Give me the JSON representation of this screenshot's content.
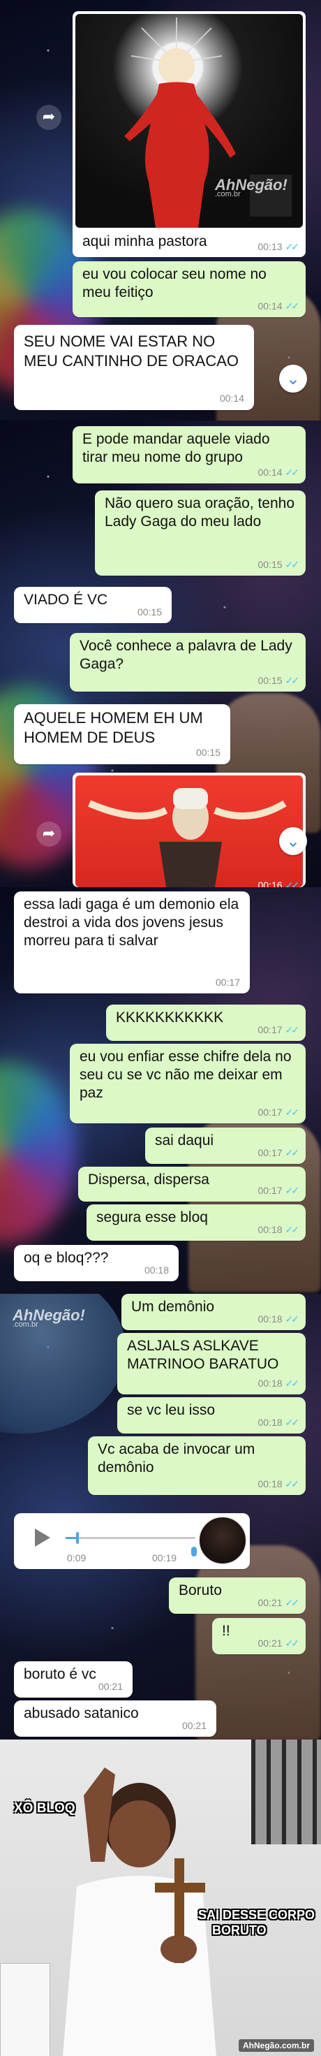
{
  "panel1": {
    "photo_watermark": "AhNegão!",
    "photo_watermark_sub": ".com.br",
    "messages": [
      {
        "text": "aqui minha pastora",
        "time": "00:13"
      },
      {
        "text": "eu vou colocar seu nome no meu feitiço",
        "time": "00:14"
      },
      {
        "text": "SEU NOME VAI ESTAR NO MEU CANTINHO DE ORACAO",
        "time": "00:14"
      }
    ]
  },
  "panel2": {
    "messages": [
      {
        "text": "E pode mandar aquele viado tirar meu nome do grupo",
        "time": "00:14"
      },
      {
        "text": "Não quero sua oração, tenho Lady Gaga do meu lado",
        "time": "00:15"
      },
      {
        "text": "VIADO É VC",
        "time": "00:15"
      },
      {
        "text": "Você conhece a palavra de Lady Gaga?",
        "time": "00:15"
      },
      {
        "text": "AQUELE HOMEM EH UM HOMEM DE DEUS",
        "time": "00:15"
      },
      {
        "text": "",
        "time": "00:16"
      }
    ]
  },
  "panel3": {
    "messages": [
      {
        "text": "essa ladi gaga é um demonio ela destroi a vida dos jovens jesus morreu para ti salvar",
        "time": "00:17"
      },
      {
        "text": "KKKKKKKKKKK",
        "time": "00:17"
      },
      {
        "text": "eu vou enfiar esse chifre dela no seu cu se vc não me deixar em paz",
        "time": "00:17"
      },
      {
        "text": "sai daqui",
        "time": "00:17"
      },
      {
        "text": "Dispersa, dispersa",
        "time": "00:17"
      },
      {
        "text": "segura esse bloq",
        "time": "00:18"
      },
      {
        "text": "oq e bloq???",
        "time": "00:18"
      }
    ]
  },
  "panel4": {
    "watermark": "AhNegão!",
    "watermark_sub": ".com.br",
    "messages": [
      {
        "text": "Um demônio",
        "time": "00:18"
      },
      {
        "text": "ASLJALS ASLKAVE MATRINOO BARATUO",
        "time": "00:18"
      },
      {
        "text": "se vc leu isso",
        "time": "00:18"
      },
      {
        "text": "Vc acaba de invocar um demônio",
        "time": "00:18"
      },
      {
        "text": "Boruto",
        "time": "00:21"
      },
      {
        "text": "!!",
        "time": "00:21"
      },
      {
        "text": "boruto é vc",
        "time": "00:21"
      },
      {
        "text": "abusado satanico",
        "time": "00:21"
      }
    ],
    "audio": {
      "elapsed": "0:09",
      "time": "00:19",
      "progress": 0.08
    }
  },
  "meme": {
    "caption_left": "XÔ BLOQ",
    "caption_right_1": "SAI DESSE CORPO",
    "caption_right_2": "BORUTO",
    "watermark": "AhNegão.com.br"
  },
  "icons": {
    "forward": "forward-arrow-icon",
    "scroll_down": "chevron-down-icon",
    "ticks": "double-check-icon",
    "play": "play-icon",
    "mic": "microphone-icon"
  },
  "colors": {
    "outgoing": "#dcf8c6",
    "incoming": "#ffffff",
    "ticks": "#4fc3f7",
    "timestamp": "#8a8a8a"
  }
}
